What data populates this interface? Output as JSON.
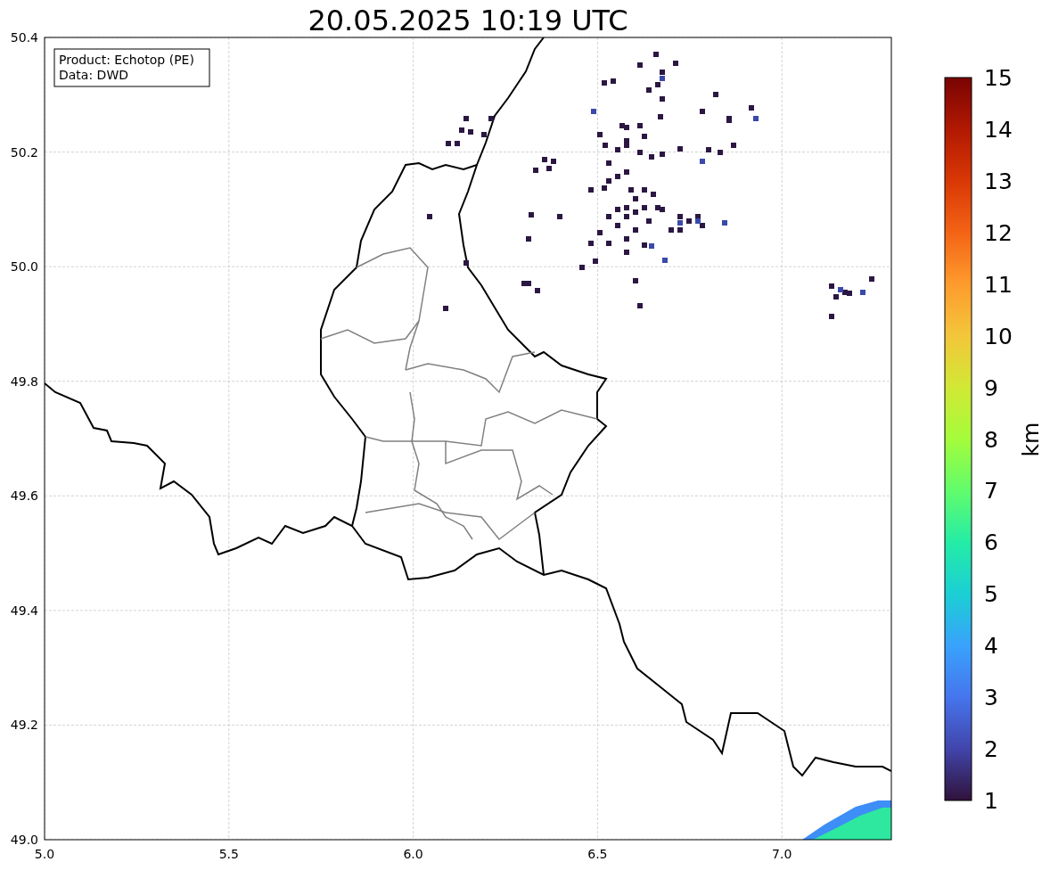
{
  "title": "20.05.2025 10:19 UTC",
  "legend": [
    "Product: Echotop (PE)",
    "Data: DWD"
  ],
  "x_ticks": [
    "5.0",
    "5.5",
    "6.0",
    "6.5",
    "7.0"
  ],
  "y_ticks": [
    "50.4",
    "50.2",
    "50.0",
    "49.8",
    "49.6",
    "49.4",
    "49.2",
    "49.0"
  ],
  "colorbar": {
    "label": "km",
    "ticks": [
      "15",
      "14",
      "13",
      "12",
      "11",
      "10",
      "9",
      "8",
      "7",
      "6",
      "5",
      "4",
      "3",
      "2",
      "1"
    ]
  }
}
